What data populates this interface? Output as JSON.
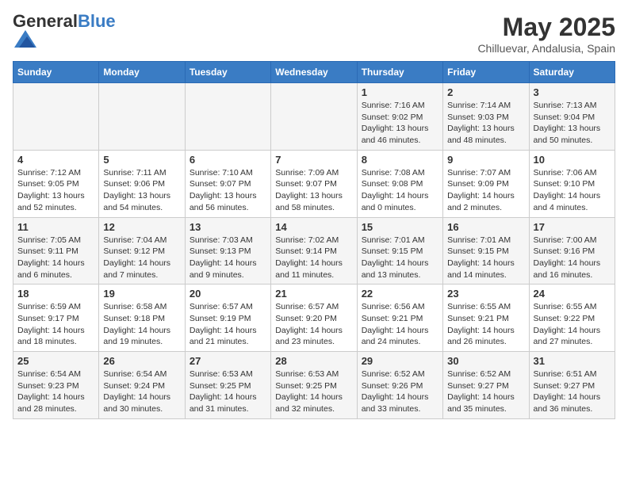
{
  "header": {
    "logo_general": "General",
    "logo_blue": "Blue",
    "month_title": "May 2025",
    "subtitle": "Chilluevar, Andalusia, Spain"
  },
  "days_of_week": [
    "Sunday",
    "Monday",
    "Tuesday",
    "Wednesday",
    "Thursday",
    "Friday",
    "Saturday"
  ],
  "weeks": [
    [
      {
        "day": "",
        "sunrise": "",
        "sunset": "",
        "daylight": ""
      },
      {
        "day": "",
        "sunrise": "",
        "sunset": "",
        "daylight": ""
      },
      {
        "day": "",
        "sunrise": "",
        "sunset": "",
        "daylight": ""
      },
      {
        "day": "",
        "sunrise": "",
        "sunset": "",
        "daylight": ""
      },
      {
        "day": "1",
        "sunrise": "Sunrise: 7:16 AM",
        "sunset": "Sunset: 9:02 PM",
        "daylight": "Daylight: 13 hours and 46 minutes."
      },
      {
        "day": "2",
        "sunrise": "Sunrise: 7:14 AM",
        "sunset": "Sunset: 9:03 PM",
        "daylight": "Daylight: 13 hours and 48 minutes."
      },
      {
        "day": "3",
        "sunrise": "Sunrise: 7:13 AM",
        "sunset": "Sunset: 9:04 PM",
        "daylight": "Daylight: 13 hours and 50 minutes."
      }
    ],
    [
      {
        "day": "4",
        "sunrise": "Sunrise: 7:12 AM",
        "sunset": "Sunset: 9:05 PM",
        "daylight": "Daylight: 13 hours and 52 minutes."
      },
      {
        "day": "5",
        "sunrise": "Sunrise: 7:11 AM",
        "sunset": "Sunset: 9:06 PM",
        "daylight": "Daylight: 13 hours and 54 minutes."
      },
      {
        "day": "6",
        "sunrise": "Sunrise: 7:10 AM",
        "sunset": "Sunset: 9:07 PM",
        "daylight": "Daylight: 13 hours and 56 minutes."
      },
      {
        "day": "7",
        "sunrise": "Sunrise: 7:09 AM",
        "sunset": "Sunset: 9:07 PM",
        "daylight": "Daylight: 13 hours and 58 minutes."
      },
      {
        "day": "8",
        "sunrise": "Sunrise: 7:08 AM",
        "sunset": "Sunset: 9:08 PM",
        "daylight": "Daylight: 14 hours and 0 minutes."
      },
      {
        "day": "9",
        "sunrise": "Sunrise: 7:07 AM",
        "sunset": "Sunset: 9:09 PM",
        "daylight": "Daylight: 14 hours and 2 minutes."
      },
      {
        "day": "10",
        "sunrise": "Sunrise: 7:06 AM",
        "sunset": "Sunset: 9:10 PM",
        "daylight": "Daylight: 14 hours and 4 minutes."
      }
    ],
    [
      {
        "day": "11",
        "sunrise": "Sunrise: 7:05 AM",
        "sunset": "Sunset: 9:11 PM",
        "daylight": "Daylight: 14 hours and 6 minutes."
      },
      {
        "day": "12",
        "sunrise": "Sunrise: 7:04 AM",
        "sunset": "Sunset: 9:12 PM",
        "daylight": "Daylight: 14 hours and 7 minutes."
      },
      {
        "day": "13",
        "sunrise": "Sunrise: 7:03 AM",
        "sunset": "Sunset: 9:13 PM",
        "daylight": "Daylight: 14 hours and 9 minutes."
      },
      {
        "day": "14",
        "sunrise": "Sunrise: 7:02 AM",
        "sunset": "Sunset: 9:14 PM",
        "daylight": "Daylight: 14 hours and 11 minutes."
      },
      {
        "day": "15",
        "sunrise": "Sunrise: 7:01 AM",
        "sunset": "Sunset: 9:15 PM",
        "daylight": "Daylight: 14 hours and 13 minutes."
      },
      {
        "day": "16",
        "sunrise": "Sunrise: 7:01 AM",
        "sunset": "Sunset: 9:15 PM",
        "daylight": "Daylight: 14 hours and 14 minutes."
      },
      {
        "day": "17",
        "sunrise": "Sunrise: 7:00 AM",
        "sunset": "Sunset: 9:16 PM",
        "daylight": "Daylight: 14 hours and 16 minutes."
      }
    ],
    [
      {
        "day": "18",
        "sunrise": "Sunrise: 6:59 AM",
        "sunset": "Sunset: 9:17 PM",
        "daylight": "Daylight: 14 hours and 18 minutes."
      },
      {
        "day": "19",
        "sunrise": "Sunrise: 6:58 AM",
        "sunset": "Sunset: 9:18 PM",
        "daylight": "Daylight: 14 hours and 19 minutes."
      },
      {
        "day": "20",
        "sunrise": "Sunrise: 6:57 AM",
        "sunset": "Sunset: 9:19 PM",
        "daylight": "Daylight: 14 hours and 21 minutes."
      },
      {
        "day": "21",
        "sunrise": "Sunrise: 6:57 AM",
        "sunset": "Sunset: 9:20 PM",
        "daylight": "Daylight: 14 hours and 23 minutes."
      },
      {
        "day": "22",
        "sunrise": "Sunrise: 6:56 AM",
        "sunset": "Sunset: 9:21 PM",
        "daylight": "Daylight: 14 hours and 24 minutes."
      },
      {
        "day": "23",
        "sunrise": "Sunrise: 6:55 AM",
        "sunset": "Sunset: 9:21 PM",
        "daylight": "Daylight: 14 hours and 26 minutes."
      },
      {
        "day": "24",
        "sunrise": "Sunrise: 6:55 AM",
        "sunset": "Sunset: 9:22 PM",
        "daylight": "Daylight: 14 hours and 27 minutes."
      }
    ],
    [
      {
        "day": "25",
        "sunrise": "Sunrise: 6:54 AM",
        "sunset": "Sunset: 9:23 PM",
        "daylight": "Daylight: 14 hours and 28 minutes."
      },
      {
        "day": "26",
        "sunrise": "Sunrise: 6:54 AM",
        "sunset": "Sunset: 9:24 PM",
        "daylight": "Daylight: 14 hours and 30 minutes."
      },
      {
        "day": "27",
        "sunrise": "Sunrise: 6:53 AM",
        "sunset": "Sunset: 9:25 PM",
        "daylight": "Daylight: 14 hours and 31 minutes."
      },
      {
        "day": "28",
        "sunrise": "Sunrise: 6:53 AM",
        "sunset": "Sunset: 9:25 PM",
        "daylight": "Daylight: 14 hours and 32 minutes."
      },
      {
        "day": "29",
        "sunrise": "Sunrise: 6:52 AM",
        "sunset": "Sunset: 9:26 PM",
        "daylight": "Daylight: 14 hours and 33 minutes."
      },
      {
        "day": "30",
        "sunrise": "Sunrise: 6:52 AM",
        "sunset": "Sunset: 9:27 PM",
        "daylight": "Daylight: 14 hours and 35 minutes."
      },
      {
        "day": "31",
        "sunrise": "Sunrise: 6:51 AM",
        "sunset": "Sunset: 9:27 PM",
        "daylight": "Daylight: 14 hours and 36 minutes."
      }
    ]
  ]
}
